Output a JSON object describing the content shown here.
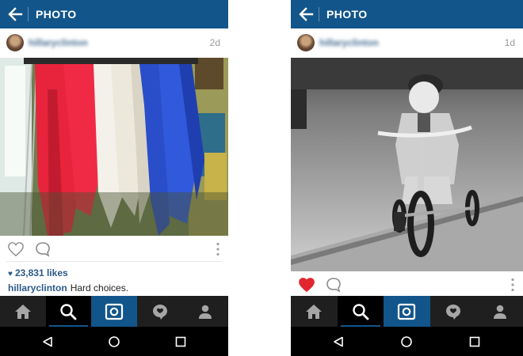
{
  "screens": [
    {
      "top_bar": {
        "title": "PHOTO"
      },
      "post": {
        "username": "hillaryclinton",
        "time": "2d",
        "liked": false,
        "likes": "23,831 likes",
        "caption_user": "hillaryclinton",
        "caption_text": "Hard choices.",
        "photo_description": "rack of colorful jackets"
      }
    },
    {
      "top_bar": {
        "title": "PHOTO"
      },
      "post": {
        "username": "hillaryclinton",
        "time": "1d",
        "liked": true,
        "photo_description": "black and white child on tricycle"
      }
    }
  ],
  "colors": {
    "brand_blue": "#12558a",
    "like_red": "#e0262e",
    "nav_dark": "#1f1f1f"
  },
  "icons": {
    "top_bar": [
      "back-arrow-icon"
    ],
    "actions": [
      "heart-icon",
      "comment-icon",
      "more-vertical-icon"
    ],
    "bottom_nav": [
      "home-icon",
      "search-icon",
      "camera-icon",
      "activity-icon",
      "profile-icon"
    ],
    "system_nav": [
      "back-triangle-icon",
      "home-circle-icon",
      "recents-square-icon"
    ]
  }
}
